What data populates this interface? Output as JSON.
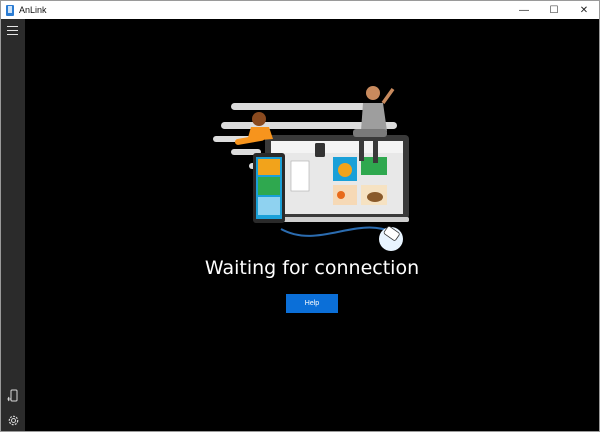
{
  "window": {
    "title": "AnLink",
    "controls": {
      "minimize": "—",
      "maximize": "☐",
      "close": "✕"
    }
  },
  "sidebar": {
    "menu_icon": "hamburger-icon",
    "bottom_icons": [
      "phone-connect-icon",
      "gear-icon"
    ]
  },
  "main": {
    "status": "Waiting for connection",
    "help_label": "Help"
  },
  "colors": {
    "accent": "#0b6fd8",
    "sidebar": "#2b2b2b",
    "background": "#000000"
  }
}
